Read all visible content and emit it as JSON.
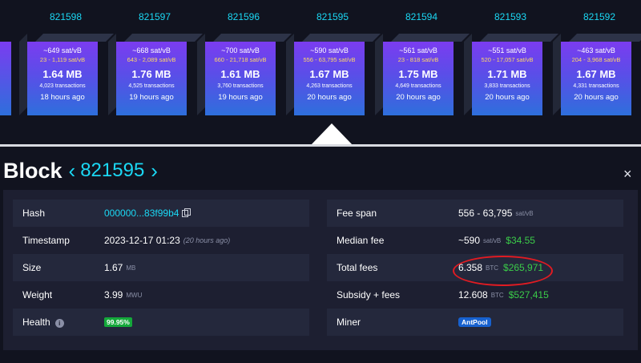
{
  "blocks": [
    {
      "height": "821598",
      "median": "~649 sat/vB",
      "range": "23 - 1,119 sat/vB",
      "size": "1.64 MB",
      "tx": "4,023 transactions",
      "time": "18 hours ago"
    },
    {
      "height": "821597",
      "median": "~668 sat/vB",
      "range": "643 - 2,089 sat/vB",
      "size": "1.76 MB",
      "tx": "4,525 transactions",
      "time": "19 hours ago"
    },
    {
      "height": "821596",
      "median": "~700 sat/vB",
      "range": "660 - 21,718 sat/vB",
      "size": "1.61 MB",
      "tx": "3,760 transactions",
      "time": "19 hours ago"
    },
    {
      "height": "821595",
      "median": "~590 sat/vB",
      "range": "556 - 63,795 sat/vB",
      "size": "1.67 MB",
      "tx": "4,263 transactions",
      "time": "20 hours ago"
    },
    {
      "height": "821594",
      "median": "~561 sat/vB",
      "range": "23 - 818 sat/vB",
      "size": "1.75 MB",
      "tx": "4,649 transactions",
      "time": "20 hours ago"
    },
    {
      "height": "821593",
      "median": "~551 sat/vB",
      "range": "520 - 17,057 sat/vB",
      "size": "1.71 MB",
      "tx": "3,833 transactions",
      "time": "20 hours ago"
    },
    {
      "height": "821592",
      "median": "~463 sat/vB",
      "range": "204 - 3,968 sat/vB",
      "size": "1.67 MB",
      "tx": "4,331 transactions",
      "time": "20 hours ago"
    }
  ],
  "header": {
    "title": "Block",
    "prev": "‹",
    "number": "821595",
    "next": "›",
    "close": "×"
  },
  "left": {
    "hash_label": "Hash",
    "hash_value": "000000...83f99b4",
    "timestamp_label": "Timestamp",
    "timestamp_value": "2023-12-17 01:23",
    "timestamp_rel": "(20 hours ago)",
    "size_label": "Size",
    "size_value": "1.67",
    "size_unit": "MB",
    "weight_label": "Weight",
    "weight_value": "3.99",
    "weight_unit": "MWU",
    "health_label": "Health",
    "health_value": "99.95%",
    "health_info": "i"
  },
  "right": {
    "feespan_label": "Fee span",
    "feespan_value": "556 - 63,795",
    "feespan_unit": "sat/vB",
    "median_label": "Median fee",
    "median_value": "~590",
    "median_unit": "sat/vB",
    "median_usd": "$34.55",
    "total_label": "Total fees",
    "total_value": "6.358",
    "total_unit": "BTC",
    "total_usd": "$265,971",
    "subsidy_label": "Subsidy + fees",
    "subsidy_value": "12.608",
    "subsidy_unit": "BTC",
    "subsidy_usd": "$527,415",
    "miner_label": "Miner",
    "miner_value": "AntPool"
  },
  "colors": {
    "accent": "#1bd8f4",
    "green": "#3bcc49",
    "highlight": "#e11b22"
  }
}
